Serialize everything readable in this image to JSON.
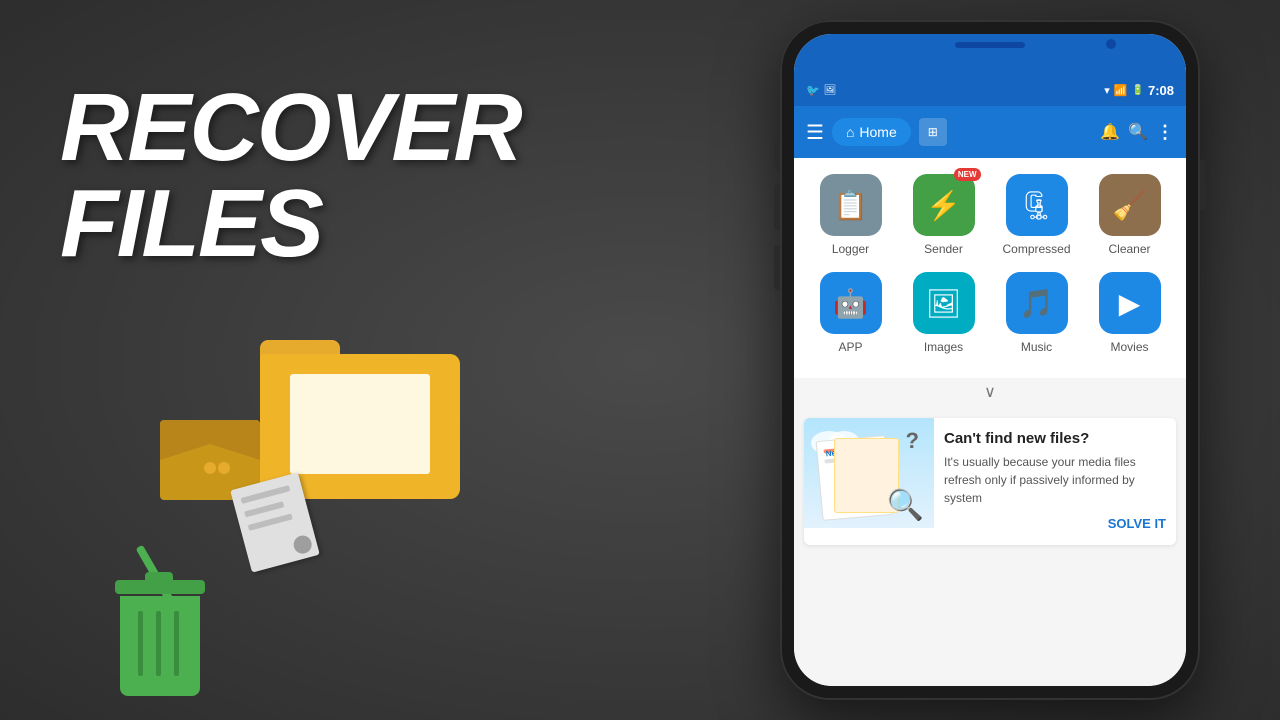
{
  "background": {
    "color": "#3a3a3a"
  },
  "hero": {
    "title": "RECOVER\nFILES"
  },
  "phone": {
    "status_bar": {
      "time": "7:08",
      "icons_left": [
        "app-icon",
        "image-icon"
      ],
      "icons_right": [
        "wifi-icon",
        "signal-icon",
        "battery-icon"
      ]
    },
    "app_bar": {
      "menu_icon": "☰",
      "home_label": "Home",
      "view_icon": "⊞",
      "bell_icon": "🔔",
      "search_icon": "🔍",
      "more_icon": "⋮"
    },
    "grid_row1": [
      {
        "id": "logger",
        "label": "Logger",
        "icon": "📋",
        "bg": "#78909c",
        "new": false
      },
      {
        "id": "sender",
        "label": "Sender",
        "icon": "⚡",
        "bg": "#43a047",
        "new": true
      },
      {
        "id": "compressed",
        "label": "Compressed",
        "icon": "🗜",
        "bg": "#1e88e5",
        "new": false
      },
      {
        "id": "cleaner",
        "label": "Cleaner",
        "icon": "🧹",
        "bg": "#8d6e4d",
        "new": false
      }
    ],
    "grid_row2": [
      {
        "id": "app",
        "label": "APP",
        "icon": "🤖",
        "bg": "#1e88e5",
        "new": false
      },
      {
        "id": "images",
        "label": "Images",
        "icon": "🖼",
        "bg": "#00acc1",
        "new": false
      },
      {
        "id": "music",
        "label": "Music",
        "icon": "🎵",
        "bg": "#1e88e5",
        "new": false
      },
      {
        "id": "movies",
        "label": "Movies",
        "icon": "▶",
        "bg": "#1e88e5",
        "new": false
      }
    ],
    "info_card": {
      "title": "Can't find new files?",
      "body": "It's usually because your media files refresh only if passively informed by system",
      "action_label": "SOLVE IT"
    },
    "new_badge": "NEW"
  }
}
